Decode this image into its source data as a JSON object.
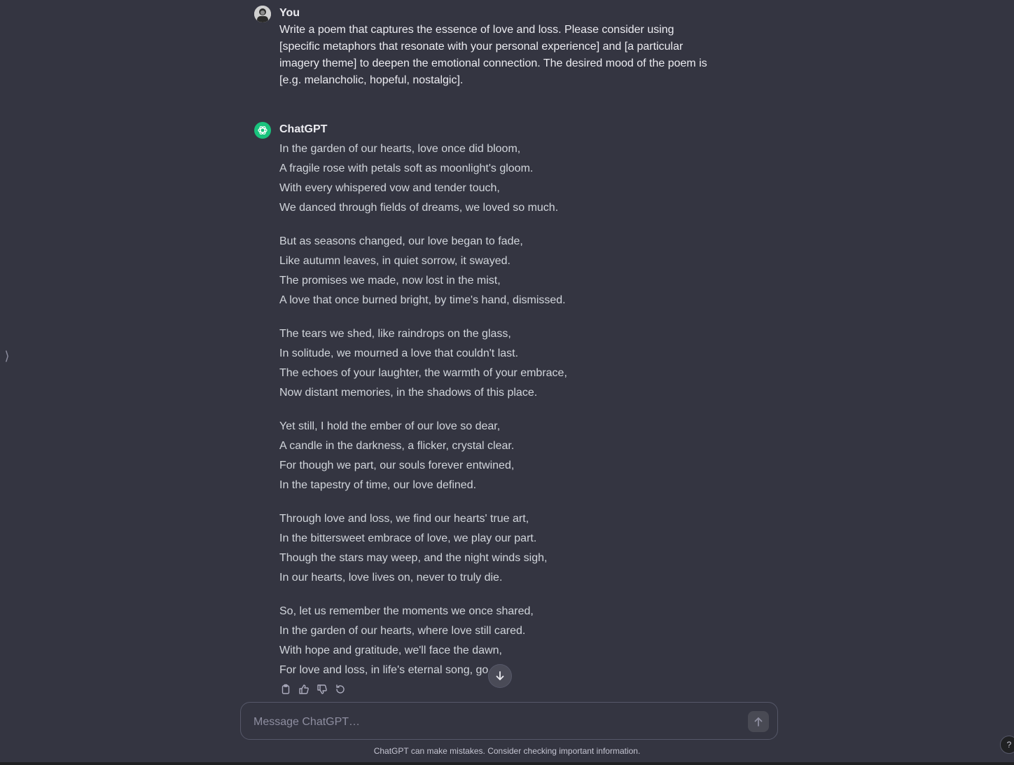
{
  "user_message": {
    "author": "You",
    "text": "Write a poem that captures the essence of love and loss. Please consider using [specific metaphors that resonate with your personal experience] and [a particular imagery theme] to deepen the emotional connection. The desired mood of the poem is [e.g. melancholic, hopeful, nostalgic]."
  },
  "assistant_message": {
    "author": "ChatGPT",
    "stanzas": [
      [
        "In the garden of our hearts, love once did bloom,",
        "A fragile rose with petals soft as moonlight's gloom.",
        "With every whispered vow and tender touch,",
        "We danced through fields of dreams, we loved so much."
      ],
      [
        "But as seasons changed, our love began to fade,",
        "Like autumn leaves, in quiet sorrow, it swayed.",
        "The promises we made, now lost in the mist,",
        "A love that once burned bright, by time's hand, dismissed."
      ],
      [
        "The tears we shed, like raindrops on the glass,",
        "In solitude, we mourned a love that couldn't last.",
        "The echoes of your laughter, the warmth of your embrace,",
        "Now distant memories, in the shadows of this place."
      ],
      [
        "Yet still, I hold the ember of our love so dear,",
        "A candle in the darkness, a flicker, crystal clear.",
        "For though we part, our souls forever entwined,",
        "In the tapestry of time, our love defined."
      ],
      [
        "Through love and loss, we find our hearts' true art,",
        "In the bittersweet embrace of love, we play our part.",
        "Though the stars may weep, and the night winds sigh,",
        "In our hearts, love lives on, never to truly die."
      ],
      [
        "So, let us remember the moments we once shared,",
        "In the garden of our hearts, where love still cared.",
        "With hope and gratitude, we'll face the dawn,",
        "For love and loss, in life's eternal song, go on."
      ]
    ],
    "action_icons": [
      "copy-icon",
      "thumbs-up-icon",
      "thumbs-down-icon",
      "regenerate-icon"
    ]
  },
  "composer": {
    "placeholder": "Message ChatGPT…",
    "value": ""
  },
  "footer": {
    "disclaimer": "ChatGPT can make mistakes. Consider checking important information.",
    "help_label": "?"
  },
  "colors": {
    "background": "#343541",
    "text": "#ececf1",
    "accent_green": "#19c37d"
  }
}
